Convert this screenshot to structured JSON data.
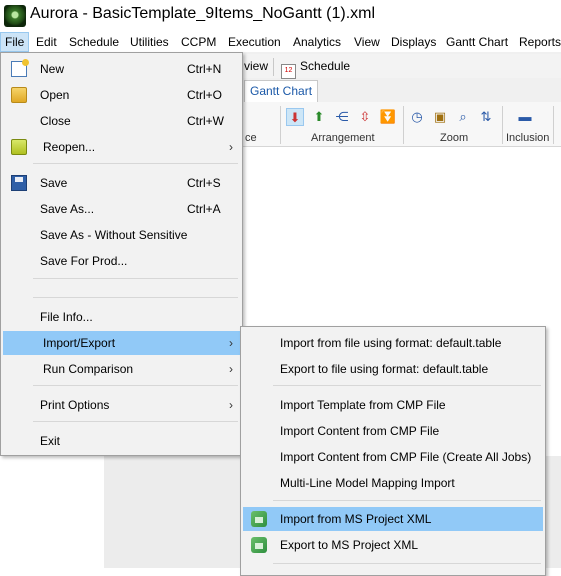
{
  "window": {
    "title": "Aurora - BasicTemplate_9Items_NoGantt (1).xml"
  },
  "menubar": [
    "File",
    "Edit",
    "Schedule",
    "Utilities",
    "CCPM",
    "Execution",
    "Analytics",
    "View",
    "Displays",
    "Gantt Chart",
    "Reports"
  ],
  "toolbar": {
    "view_partial": "view",
    "schedule": "Schedule",
    "cal_day": "12"
  },
  "tabs": {
    "gantt": "Gantt Chart"
  },
  "ribbon": {
    "groups": [
      "ce",
      "Arrangement",
      "Zoom",
      "Inclusion"
    ]
  },
  "file_menu": {
    "items": [
      {
        "label": "New",
        "shortcut": "Ctrl+N",
        "icon": "new-document-icon"
      },
      {
        "label": "Open",
        "shortcut": "Ctrl+O",
        "icon": "open-folder-icon"
      },
      {
        "label": "Close",
        "shortcut": "Ctrl+W"
      },
      {
        "label": "Reopen...",
        "submenu": true,
        "icon": "reopen-folder-icon"
      },
      {
        "label": "Save",
        "shortcut": "Ctrl+S",
        "icon": "save-disk-icon"
      },
      {
        "label": "Save As...",
        "shortcut": "Ctrl+A"
      },
      {
        "label": "Save As - Without Sensitive"
      },
      {
        "label": "Save For Prod..."
      },
      {
        "label": "File Info..."
      },
      {
        "label": "Import/Export",
        "submenu": true,
        "highlighted": true
      },
      {
        "label": "Run Comparison",
        "submenu": true
      },
      {
        "label": "Print Options",
        "submenu": true
      },
      {
        "label": "Exit"
      }
    ],
    "arrow": "›"
  },
  "submenu": {
    "items": [
      {
        "label": "Import from file using format: default.table"
      },
      {
        "label": "Export to file using format: default.table"
      },
      {
        "label": "Import Template from CMP File"
      },
      {
        "label": "Import Content from CMP File"
      },
      {
        "label": "Import Content from CMP File (Create All Jobs)"
      },
      {
        "label": "Multi-Line Model Mapping Import"
      },
      {
        "label": "Import from MS Project XML",
        "highlighted": true,
        "icon": "ms-project-import-icon"
      },
      {
        "label": "Export to MS Project XML",
        "icon": "ms-project-export-icon"
      }
    ]
  },
  "colors": {
    "highlight": "#91c9f7",
    "menu_bg": "#f2f2f2",
    "menubar_active": "#cce4f7"
  }
}
